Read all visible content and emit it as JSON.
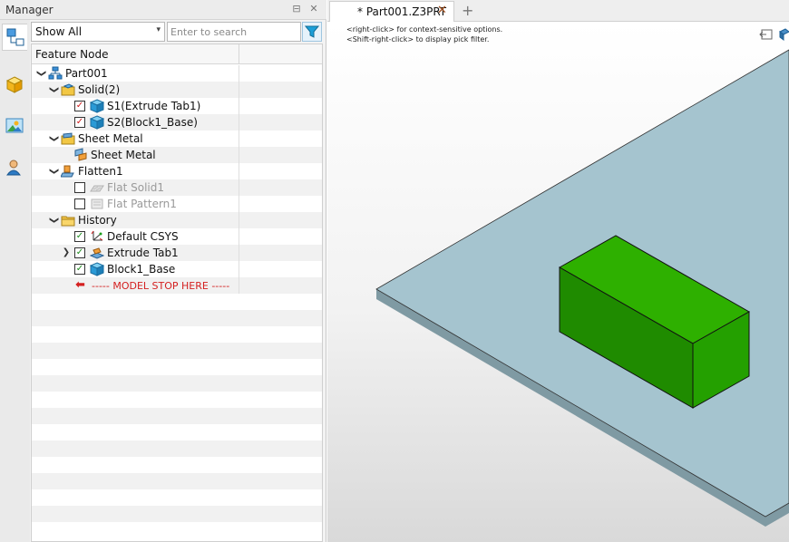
{
  "manager": {
    "title": "Manager",
    "pin_glyph": "⊟",
    "close_glyph": "✕",
    "side_tabs": [
      {
        "name": "history-manager",
        "icon": "feature-tree-icon",
        "active": true
      },
      {
        "name": "part-view",
        "icon": "cube-icon",
        "active": false
      },
      {
        "name": "view-manager",
        "icon": "image-icon",
        "active": false
      },
      {
        "name": "user-manager",
        "icon": "user-icon",
        "active": false
      }
    ],
    "filter": {
      "value": "Show All",
      "arrow": "▾"
    },
    "search": {
      "placeholder": "Enter to search",
      "value": ""
    },
    "filter_button": {
      "icon": "funnel-icon"
    }
  },
  "tree": {
    "header": "Feature Node",
    "rows": [
      {
        "label": "Part001",
        "level": 0,
        "expander": "expanded",
        "checkbox": null,
        "icon": "part-hierarchy-icon",
        "dim": false
      },
      {
        "label": "Solid(2)",
        "level": 1,
        "expander": "expanded",
        "checkbox": null,
        "icon": "solid-folder-icon",
        "dim": false
      },
      {
        "label": "S1(Extrude Tab1)",
        "level": 2,
        "expander": null,
        "checkbox": "red",
        "icon": "solid-cube-icon",
        "dim": false
      },
      {
        "label": "S2(Block1_Base)",
        "level": 2,
        "expander": null,
        "checkbox": "red",
        "icon": "solid-cube-icon",
        "dim": false
      },
      {
        "label": "Sheet Metal",
        "level": 1,
        "expander": "expanded",
        "checkbox": null,
        "icon": "sheet-metal-folder-icon",
        "dim": false
      },
      {
        "label": "Sheet Metal",
        "level": 2,
        "expander": null,
        "checkbox": null,
        "icon": "sheet-metal-icon",
        "dim": false
      },
      {
        "label": "Flatten1",
        "level": 1,
        "expander": "expanded",
        "checkbox": null,
        "icon": "flatten-icon",
        "dim": false
      },
      {
        "label": "Flat Solid1",
        "level": 2,
        "expander": null,
        "checkbox": "empty",
        "icon": "flat-solid-icon",
        "dim": true
      },
      {
        "label": "Flat Pattern1",
        "level": 2,
        "expander": null,
        "checkbox": "empty",
        "icon": "flat-pattern-icon",
        "dim": true
      },
      {
        "label": "History",
        "level": 1,
        "expander": "expanded",
        "checkbox": null,
        "icon": "history-folder-icon",
        "dim": false
      },
      {
        "label": "Default CSYS",
        "level": 2,
        "expander": null,
        "checkbox": "green",
        "icon": "csys-icon",
        "dim": false
      },
      {
        "label": "Extrude Tab1",
        "level": 2,
        "expander": "collapsed",
        "checkbox": "green",
        "icon": "extrude-tab-icon",
        "dim": false
      },
      {
        "label": "Block1_Base",
        "level": 2,
        "expander": null,
        "checkbox": "green",
        "icon": "block-icon",
        "dim": false
      },
      {
        "label": "----- MODEL STOP HERE -----",
        "level": 2,
        "expander": null,
        "checkbox": null,
        "icon": "stop-arrow-icon",
        "dim": false,
        "stop": true
      }
    ],
    "empty_rows": 15
  },
  "viewport": {
    "tab_label": "* Part001.Z3PRT",
    "tab_close": "✕",
    "new_tab": "+",
    "hint_line1": "<right-click> for context-sensitive options.",
    "hint_line2": "<Shift-right-click> to display pick filter.",
    "colors": {
      "plate_top": "#a5c4cf",
      "plate_edge": "#7f9aa3",
      "block_top": "#2eb000",
      "block_front": "#1f8b00",
      "block_side": "#24a000",
      "stop_red": "#d42020",
      "check_red": "#d01818",
      "check_green": "#1a8a1a"
    }
  }
}
